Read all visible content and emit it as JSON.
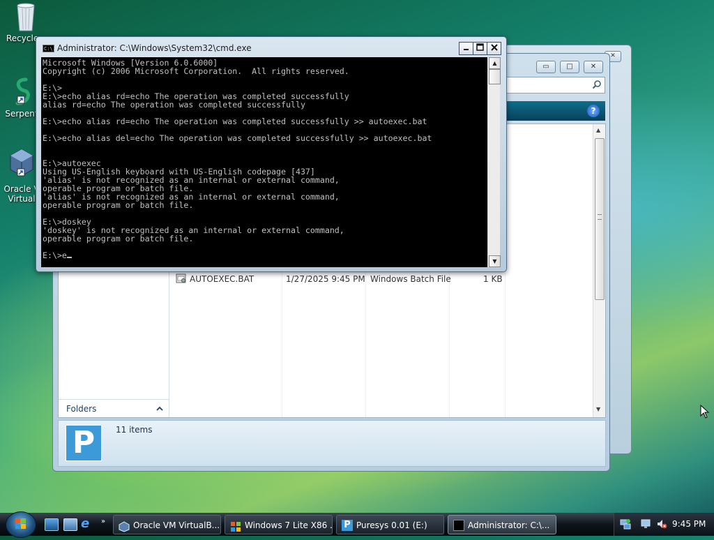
{
  "desktop": {
    "icons": [
      {
        "label": "Recycle",
        "icon": "recycle-bin-icon"
      },
      {
        "label": "Serpent",
        "icon": "serpent-icon"
      },
      {
        "label": "Oracle V",
        "label2": "Virtual",
        "icon": "virtualbox-icon"
      }
    ]
  },
  "explorer": {
    "title_buttons": [
      "▭",
      "□",
      "✕"
    ],
    "file": {
      "name": "AUTOEXEC.BAT",
      "date": "1/27/2025 9:45 PM",
      "type": "Windows Batch File",
      "size": "1 KB"
    },
    "folders_label": "Folders",
    "status": "11 items",
    "logo_letter": "P"
  },
  "cmd": {
    "title": "Administrator: C:\\Windows\\System32\\cmd.exe",
    "icon_text": "C:\\.",
    "lines": [
      "Microsoft Windows [Version 6.0.6000]",
      "Copyright (c) 2006 Microsoft Corporation.  All rights reserved.",
      "",
      "E:\\>",
      "E:\\>echo alias rd=echo The operation was completed successfully",
      "alias rd=echo The operation was completed successfully",
      "",
      "E:\\>echo alias rd=echo The operation was completed successfully >> autoexec.bat",
      "",
      "E:\\>echo alias del=echo The operation was completed successfully >> autoexec.bat",
      "",
      "",
      "E:\\>autoexec",
      "Using US-English keyboard with US-English codepage [437]",
      "'alias' is not recognized as an internal or external command,",
      "operable program or batch file.",
      "'alias' is not recognized as an internal or external command,",
      "operable program or batch file.",
      "",
      "E:\\>doskey",
      "'doskey' is not recognized as an internal or external command,",
      "operable program or batch file.",
      ""
    ],
    "prompt": "E:\\>e"
  },
  "taskbar": {
    "buttons": [
      {
        "label": "Oracle VM VirtualB...",
        "icon": "virtualbox-icon"
      },
      {
        "label": "Windows 7 Lite X86 ...",
        "icon": "windows-explorer-icon"
      },
      {
        "label": "Puresys 0.01 (E:)",
        "icon": "puresys-icon"
      },
      {
        "label": "Administrator: C:\\...",
        "icon": "cmd-icon"
      }
    ],
    "clock": "9:45 PM"
  },
  "colors": {
    "console_bg": "#000000",
    "console_fg": "#c0c0c0",
    "taskbar": "#0e141b",
    "accent": "#3c9ad8"
  }
}
